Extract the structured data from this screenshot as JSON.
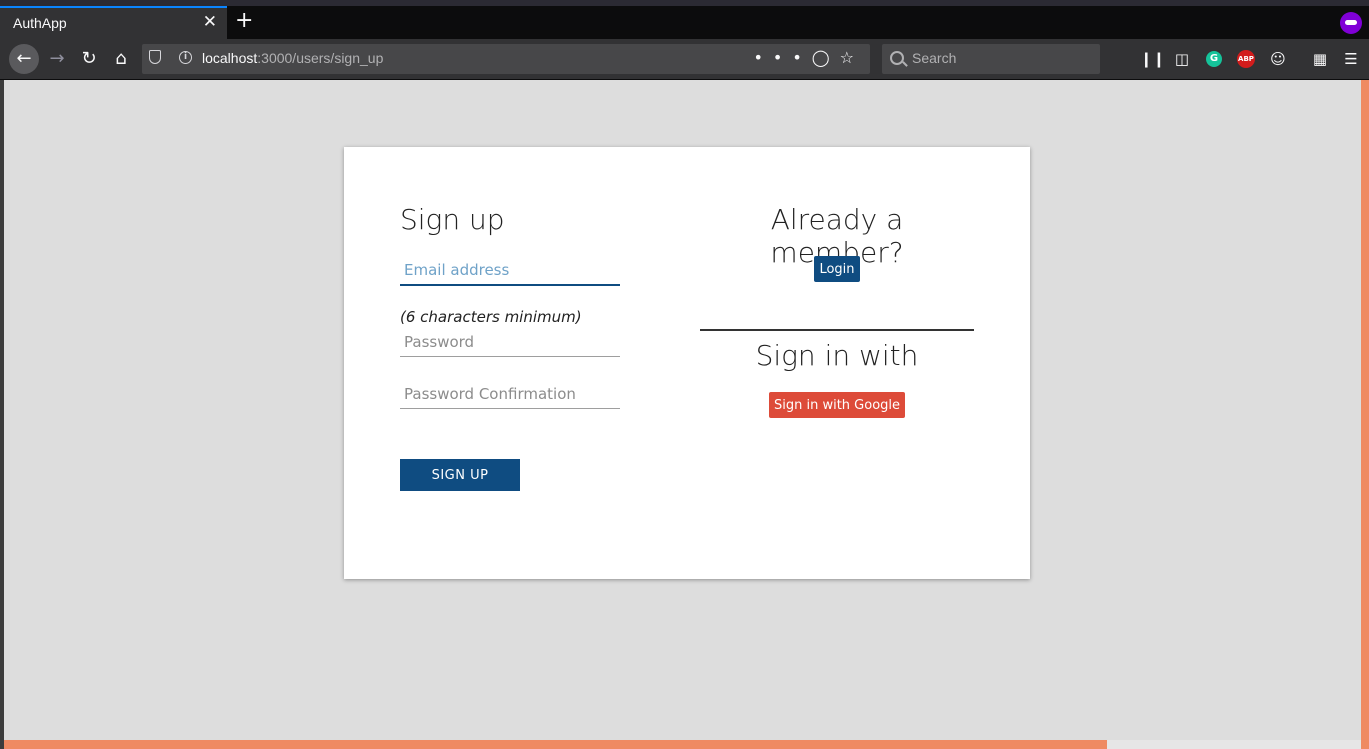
{
  "browser": {
    "tab_title": "AuthApp",
    "tab_close": "✕",
    "new_tab": "+",
    "url_host": "localhost",
    "url_rest": ":3000/users/sign_up",
    "url_actions": "•••",
    "search_placeholder": "Search",
    "icons": [
      "back-icon",
      "forward-icon",
      "reload-icon",
      "home-icon",
      "shield-icon",
      "info-icon",
      "page-actions-icon",
      "pocket-icon",
      "bookmark-star-icon",
      "search-icon",
      "library-icon",
      "sidebar-icon",
      "grammarly-icon",
      "adblock-icon",
      "account-icon",
      "extensions-icon",
      "menu-icon",
      "private-browsing-icon"
    ],
    "grammarly_label": "G",
    "abp_label": "ABP"
  },
  "signup": {
    "title": "Sign up",
    "email_placeholder": "Email address",
    "password_hint": "(6 characters minimum)",
    "password_placeholder": "Password",
    "password_confirm_placeholder": "Password Confirmation",
    "submit_label": "SIGN UP"
  },
  "member": {
    "title": "Already a member?",
    "login_label": "Login"
  },
  "oauth": {
    "title": "Sign in with",
    "google_label": "Sign in with Google"
  },
  "colors": {
    "primary": "#0f4c81",
    "google": "#dd4b39",
    "scrollbar": "#ef8a62",
    "page_bg": "#dddddd"
  }
}
